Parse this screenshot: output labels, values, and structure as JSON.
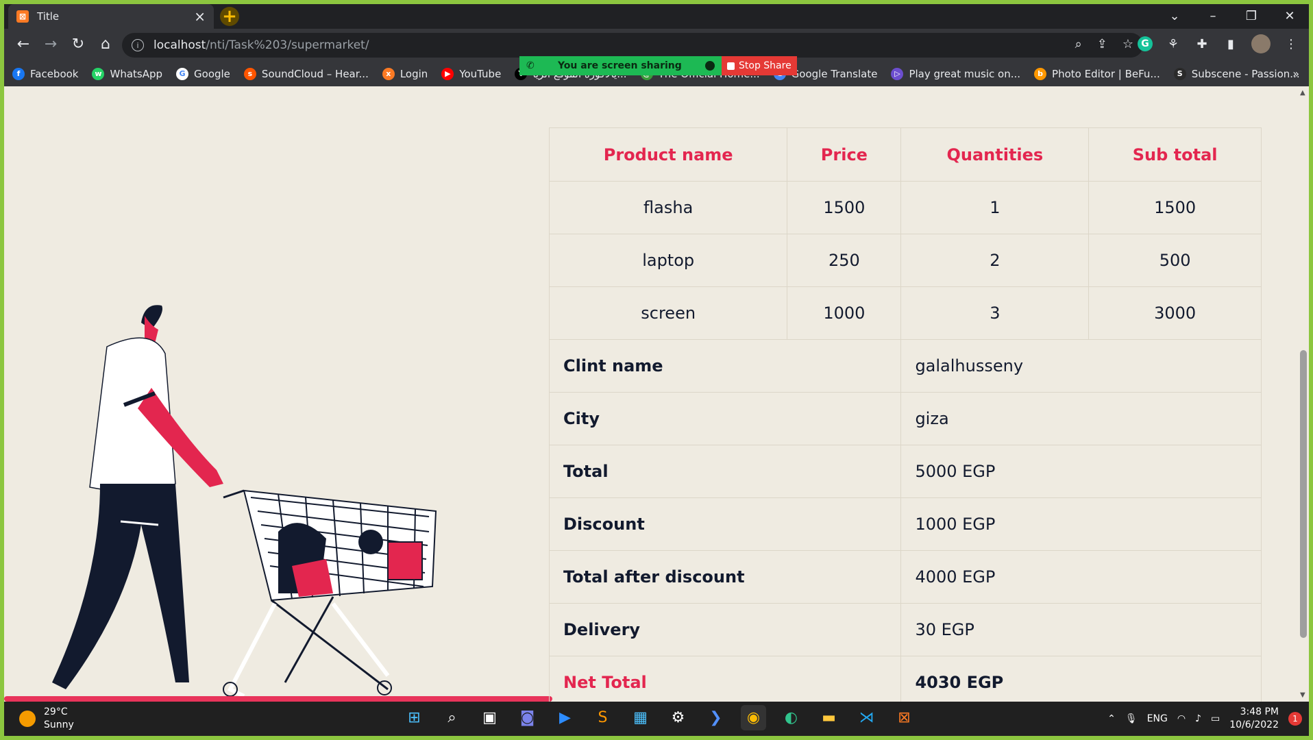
{
  "browser": {
    "tab_title": "Title",
    "url_host": "localhost",
    "url_path": "/nti/Task%203/supermarket/",
    "bookmarks": [
      {
        "label": "Facebook",
        "color": "#1877f2",
        "glyph": "f"
      },
      {
        "label": "WhatsApp",
        "color": "#25d366",
        "glyph": "w"
      },
      {
        "label": "Google",
        "color": "#ffffff",
        "glyph": "G"
      },
      {
        "label": "SoundCloud – Hear...",
        "color": "#ff5500",
        "glyph": "s"
      },
      {
        "label": "Login",
        "color": "#fb7a24",
        "glyph": "x"
      },
      {
        "label": "YouTube",
        "color": "#ff0000",
        "glyph": "▶"
      },
      {
        "label": "يالاكورة الموقع الريا...",
        "color": "#000000",
        "glyph": "Y"
      },
      {
        "label": "The Official Home...",
        "color": "#3a9b3a",
        "glyph": "@"
      },
      {
        "label": "Google Translate",
        "color": "#4285f4",
        "glyph": "G"
      },
      {
        "label": "Play great music on...",
        "color": "#6c4ecf",
        "glyph": "▷"
      },
      {
        "label": "Photo Editor | BeFu...",
        "color": "#ff9800",
        "glyph": "b"
      },
      {
        "label": "Subscene - Passion...",
        "color": "#2a2a2a",
        "glyph": "S"
      }
    ]
  },
  "share_bar": {
    "message": "You are screen sharing",
    "stop_label": "Stop Share"
  },
  "table": {
    "headers": [
      "Product name",
      "Price",
      "Quantities",
      "Sub total"
    ],
    "rows": [
      [
        "flasha",
        "1500",
        "1",
        "1500"
      ],
      [
        "laptop",
        "250",
        "2",
        "500"
      ],
      [
        "screen",
        "1000",
        "3",
        "3000"
      ]
    ],
    "summary": [
      {
        "label": "Clint name",
        "value": "galalhusseny"
      },
      {
        "label": "City",
        "value": "giza"
      },
      {
        "label": "Total",
        "value": "5000 EGP"
      },
      {
        "label": "Discount",
        "value": "1000 EGP"
      },
      {
        "label": "Total after discount",
        "value": "4000 EGP"
      },
      {
        "label": "Delivery",
        "value": "30 EGP"
      }
    ],
    "net_label": "Net Total",
    "net_value": "4030 EGP"
  },
  "taskbar": {
    "temp": "29°C",
    "condition": "Sunny",
    "lang": "ENG",
    "time": "3:48 PM",
    "date": "10/6/2022",
    "notifications": "1"
  },
  "colors": {
    "accent": "#e3264f",
    "page_bg": "#efebe1",
    "text": "#121a2e"
  }
}
